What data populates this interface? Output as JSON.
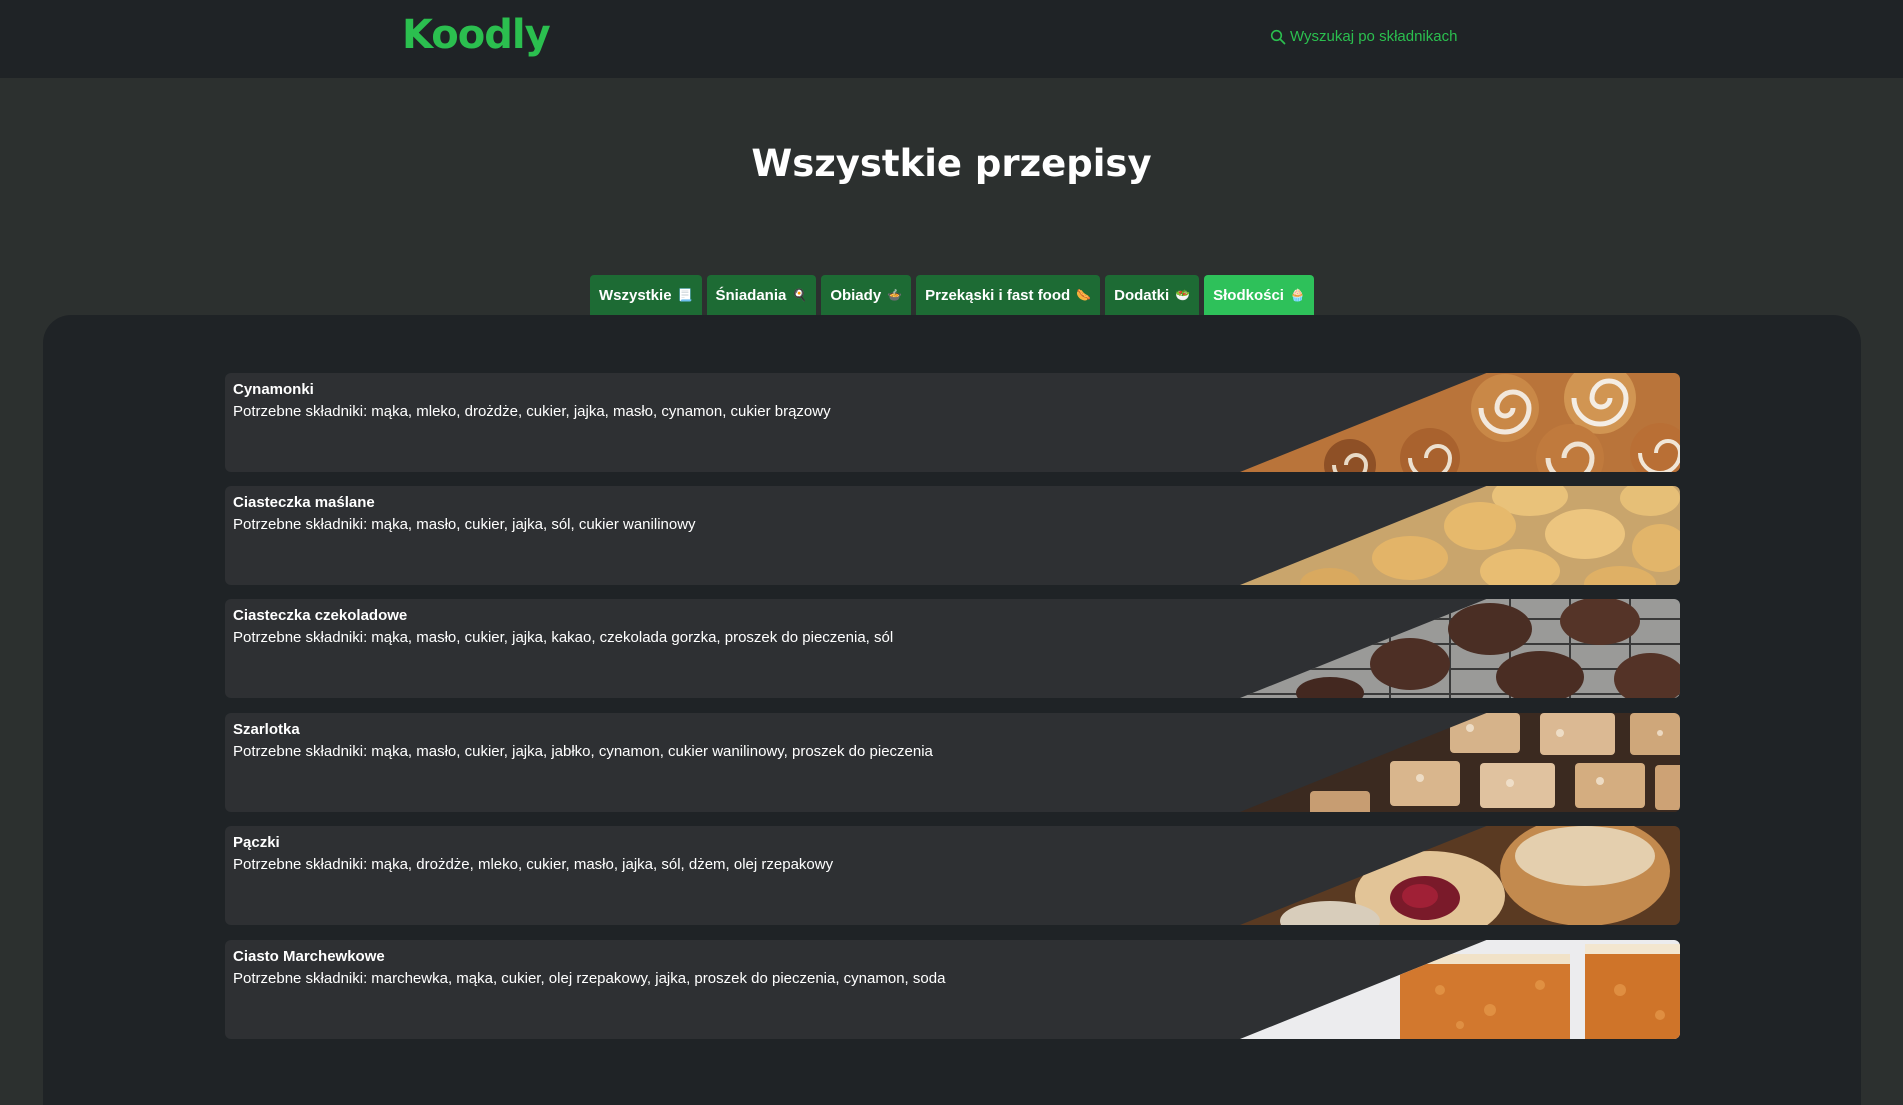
{
  "header": {
    "logo": "Koodly",
    "search_link": "Wyszukaj po składnikach"
  },
  "page_title": "Wszystkie przepisy",
  "tabs": [
    {
      "label": "Wszystkie",
      "emoji": "📃",
      "active": false
    },
    {
      "label": "Śniadania",
      "emoji": "🍳",
      "active": false
    },
    {
      "label": "Obiady",
      "emoji": "🍲",
      "active": false
    },
    {
      "label": "Przekąski i fast food",
      "emoji": "🌭",
      "active": false
    },
    {
      "label": "Dodatki",
      "emoji": "🥗",
      "active": false
    },
    {
      "label": "Słodkości",
      "emoji": "🧁",
      "active": true
    }
  ],
  "ingredients_label": "Potrzebne składniki:",
  "recipes": [
    {
      "name": "Cynamonki",
      "ingredients": "mąka, mleko, drożdże, cukier, jajka, masło, cynamon, cukier brązowy",
      "image": "cinnamon-rolls-photo"
    },
    {
      "name": "Ciasteczka maślane",
      "ingredients": "mąka, masło, cukier, jajka, sól, cukier wanilinowy",
      "image": "butter-cookies-photo"
    },
    {
      "name": "Ciasteczka czekoladowe",
      "ingredients": "mąka, masło, cukier, jajka, kakao, czekolada gorzka, proszek do pieczenia, sól",
      "image": "chocolate-cookies-photo"
    },
    {
      "name": "Szarlotka",
      "ingredients": "mąka, masło, cukier, jajka, jabłko, cynamon, cukier wanilinowy, proszek do pieczenia",
      "image": "apple-crumble-photo"
    },
    {
      "name": "Pączki",
      "ingredients": "mąka, drożdże, mleko, cukier, masło, jajka, sól, dżem, olej rzepakowy",
      "image": "donuts-photo"
    },
    {
      "name": "Ciasto Marchewkowe",
      "ingredients": "marchewka, mąka, cukier, olej rzepakowy, jajka, proszek do pieczenia, cynamon, soda",
      "image": "carrot-cake-photo"
    }
  ],
  "colors": {
    "accent": "#2bbf4f",
    "tab_bg": "#1d6b34",
    "tab_active": "#2ec15a",
    "page_bg": "#2c302f",
    "panel_bg": "#1f2326",
    "card_bg": "#2e3033"
  }
}
